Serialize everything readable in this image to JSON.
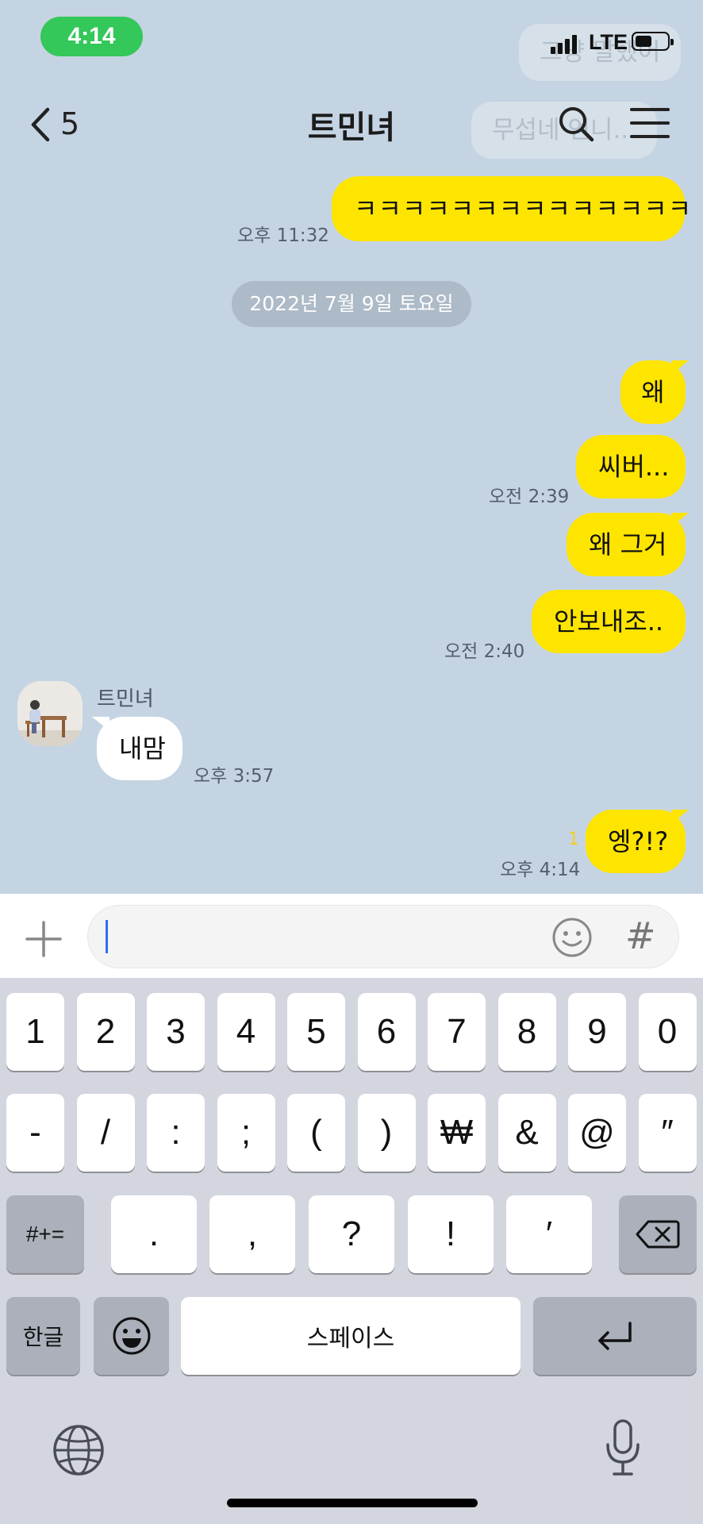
{
  "status_bar": {
    "time": "4:14",
    "network": "LTE"
  },
  "ghost_bubbles": [
    "그냥 말했어",
    "무섭네 언니..."
  ],
  "header": {
    "back_count": "5",
    "title": "트민녀"
  },
  "messages": [
    {
      "from": "me",
      "text": "ㅋㅋㅋㅋㅋㅋㅋㅋㅋㅋㅋㅋㅋㅋ",
      "time": "오후 11:32"
    },
    {
      "from": "system",
      "text": "2022년 7월 9일 토요일"
    },
    {
      "from": "me",
      "text": "왜"
    },
    {
      "from": "me",
      "text": "씨버...",
      "time": "오전 2:39"
    },
    {
      "from": "me",
      "text": "왜 그거"
    },
    {
      "from": "me",
      "text": "안보내조..",
      "time": "오전 2:40"
    },
    {
      "from": "other",
      "sender": "트민녀",
      "text": "내맘",
      "time": "오후 3:57"
    },
    {
      "from": "me",
      "text": "엥?!?",
      "time": "오후 4:14",
      "unread": "1"
    }
  ],
  "input": {
    "placeholder": ""
  },
  "keyboard": {
    "row1": [
      "1",
      "2",
      "3",
      "4",
      "5",
      "6",
      "7",
      "8",
      "9",
      "0"
    ],
    "row2": [
      "-",
      "/",
      ":",
      ";",
      "(",
      ")",
      "₩",
      "&",
      "@",
      "″"
    ],
    "row3_mode": "#+=",
    "row3": [
      ".",
      ",",
      "?",
      "!",
      "′"
    ],
    "lang_key": "한글",
    "space": "스페이스"
  },
  "colors": {
    "chat_bg": "#c5d4e3",
    "my_bubble": "#fee500",
    "other_bubble": "#ffffff",
    "time_pill": "#34c759"
  }
}
